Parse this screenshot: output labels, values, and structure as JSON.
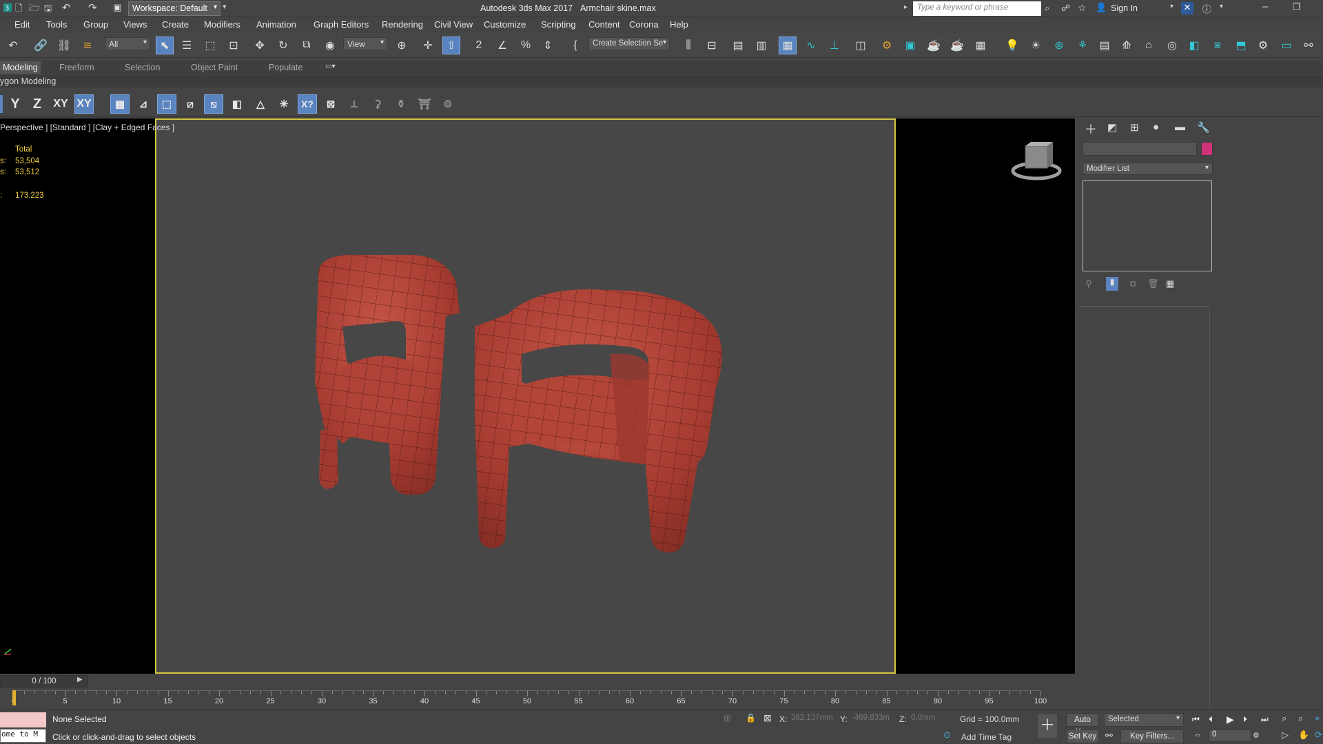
{
  "window": {
    "app_title": "Autodesk 3ds Max 2017",
    "file_name": "Armchair skine.max",
    "workspace": "Workspace: Default",
    "search_placeholder": "Type a keyword or phrase",
    "sign_in": "Sign In"
  },
  "menu": [
    "Edit",
    "Tools",
    "Group",
    "Views",
    "Create",
    "Modifiers",
    "Animation",
    "Graph Editors",
    "Rendering",
    "Civil View",
    "Customize",
    "Scripting",
    "Content",
    "Corona",
    "Help"
  ],
  "toolbar": {
    "filter": "All",
    "ref_coord": "View",
    "selection_set": "Create Selection Se"
  },
  "ribbon": {
    "tabs": [
      "Modeling",
      "Freeform",
      "Selection",
      "Object Paint",
      "Populate"
    ],
    "panel_label": "ygon Modeling"
  },
  "constraints": {
    "y": "Y",
    "z": "Z",
    "xy": "XY",
    "xy_active": "XY"
  },
  "viewport": {
    "label": "Perspective ] [Standard ] [Clay + Edged Faces ]",
    "stats": {
      "header": "Total",
      "polys_label": "s:",
      "polys": "53,504",
      "verts_label": "s:",
      "verts": "53,512",
      "fps_label": ":",
      "fps": "173.223"
    }
  },
  "command_panel": {
    "modifier_list": "Modifier List",
    "color_swatch": "#d1327a"
  },
  "timeline": {
    "frame_counter": "0 / 100",
    "ticks": [
      "0",
      "5",
      "10",
      "15",
      "20",
      "25",
      "30",
      "35",
      "40",
      "45",
      "50",
      "55",
      "60",
      "65",
      "70",
      "75",
      "80",
      "85",
      "90",
      "95",
      "100"
    ]
  },
  "status": {
    "maxscript": "ome to M",
    "selection": "None Selected",
    "prompt": "Click or click-and-drag to select objects",
    "x_label": "X:",
    "x_value": "382.137mm",
    "y_label": "Y:",
    "y_value": "-469.833m",
    "z_label": "Z:",
    "z_value": "0.0mm",
    "grid": "Grid = 100.0mm",
    "add_time_tag": "Add Time Tag",
    "auto_key": "Auto Key",
    "set_key": "Set Key",
    "key_mode": "Selected",
    "key_filters": "Key Filters...",
    "frame_field": "0"
  },
  "colors": {
    "viewport_border": "#d3c53d",
    "chair": "#b5473b",
    "stats": "#f0d040",
    "accent": "#5a84c0"
  }
}
